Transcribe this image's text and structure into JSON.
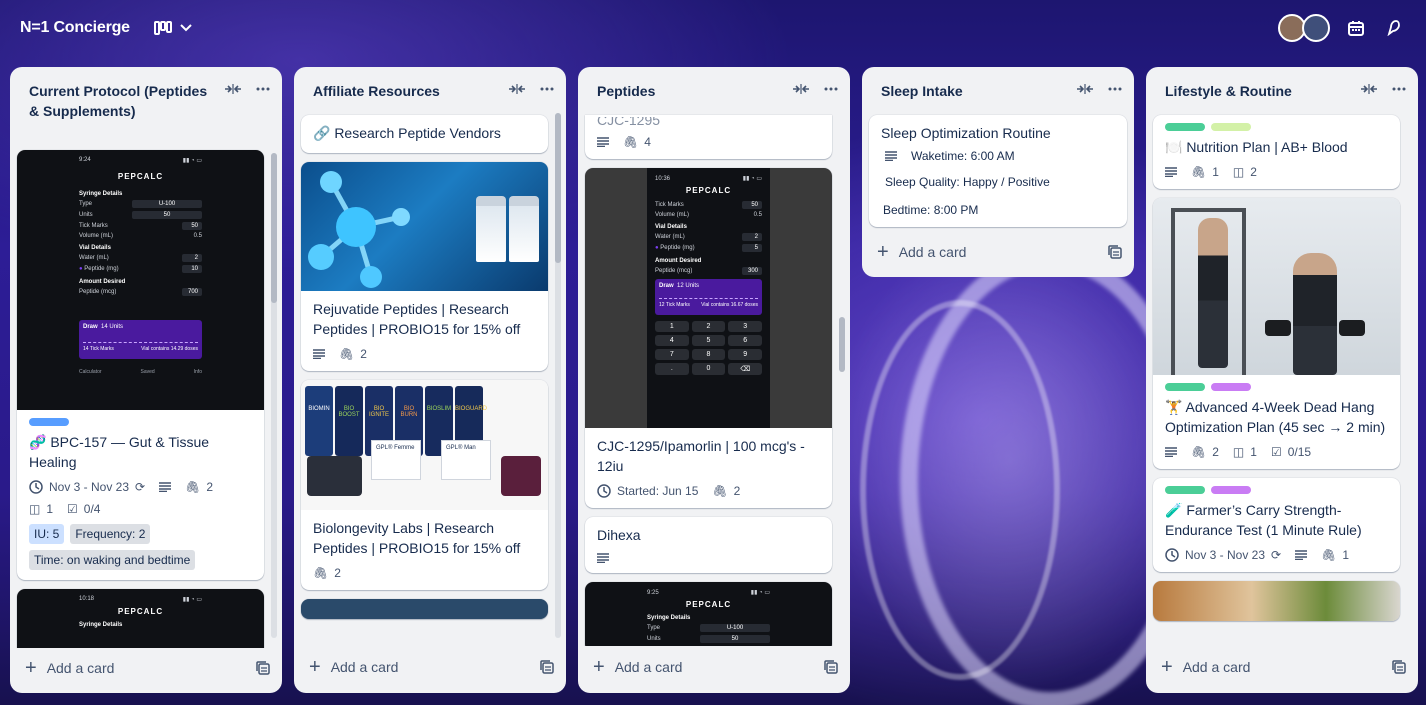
{
  "board": {
    "title": "N=1 Concierge"
  },
  "colors": {
    "label_blue": "#579dff",
    "label_green": "#4bce97",
    "label_lime": "#d3f1a7",
    "label_purple": "#c97cf4",
    "chip_iu": "#cce0ff",
    "chip_gray": "#dcdfe4"
  },
  "lists": [
    {
      "title": "Current Protocol (Peptides & Supplements)",
      "add_label": "Add a card",
      "cards": [
        {
          "title": "🧬 BPC-157 — Gut & Tissue Healing",
          "dates": "Nov 3 - Nov 23",
          "attachments": "2",
          "trello_links": "1",
          "checklist": "0/4",
          "chips": [
            "IU: 5",
            "Frequency: 2",
            "Time: on waking and bedtime"
          ],
          "cover": {
            "time": "9:24",
            "brand": "PEPCALC",
            "syringe_section": "Syringe Details",
            "type_label": "Type",
            "type_val": "U-100",
            "units_label": "Units",
            "units_val": "50",
            "ticks_label": "Tick Marks",
            "ticks_val": "50",
            "volume_label": "Volume (mL)",
            "volume_val": "0.5",
            "vial_section": "Vial Details",
            "water_label": "Water (mL)",
            "water_val": "2",
            "peptide_label": "Peptide (mg)",
            "peptide_val": "10",
            "amount_section": "Amount Desired",
            "mcg_label": "Peptide (mcg)",
            "mcg_val": "700",
            "draw_label": "Draw",
            "draw_units": "14 Units",
            "draw_ticks": "14 Tick Marks",
            "draw_contains": "Vial contains 14.29 doses",
            "tab1": "Calculator",
            "tab2": "Saved",
            "tab3": "Info"
          }
        },
        {
          "title": "",
          "cover": {
            "time": "10:18",
            "brand": "PEPCALC",
            "syringe_section": "Syringe Details"
          }
        }
      ]
    },
    {
      "title": "Affiliate Resources",
      "add_label": "Add a card",
      "cards": [
        {
          "title": "🔗 Research Peptide Vendors"
        },
        {
          "title": "Rejuvatide Peptides | Research Peptides | PROBIO15 for 15% off",
          "attachments": "2"
        },
        {
          "title": "Biolongevity Labs | Research Peptides | PROBIO15 for 15% off",
          "attachments": "2",
          "cover": {
            "vial1": "GPL® Femme",
            "vial2": "GPL® Man",
            "jar1": "BIOMIN",
            "jar2": "BIO BOOST",
            "jar3": "BIO IGNITE",
            "jar4": "BIO BURN",
            "jar5": "BIOSLIM",
            "jar6": "BIOGUARD"
          }
        }
      ]
    },
    {
      "title": "Peptides",
      "add_label": "Add a card",
      "cards": [
        {
          "title": "",
          "partial_text": "CJC-1295",
          "attachments": "4"
        },
        {
          "title": "CJC-1295/Ipamorlin | 100 mcg's - 12iu",
          "started": "Started: Jun 15",
          "attachments": "2",
          "cover": {
            "time": "10:36",
            "brand": "PEPCALC",
            "ticks_label": "Tick Marks",
            "ticks_val": "50",
            "volume_label": "Volume (mL)",
            "volume_val": "0.5",
            "vial_section": "Vial Details",
            "water_label": "Water (mL)",
            "water_val": "2",
            "peptide_label": "Peptide (mg)",
            "peptide_val": "5",
            "amount_section": "Amount Desired",
            "mcg_label": "Peptide (mcg)",
            "mcg_val": "300",
            "draw_label": "Draw",
            "draw_units": "12 Units",
            "draw_ticks": "12 Tick Marks",
            "draw_contains": "Vial contains 16.67 doses",
            "keys": [
              "1",
              "2",
              "3",
              "4",
              "5",
              "6",
              "7",
              "8",
              "9",
              ".",
              "0",
              "⌫"
            ]
          }
        },
        {
          "title": "Dihexa"
        },
        {
          "title": "",
          "cover": {
            "time": "9:25",
            "brand": "PEPCALC",
            "syringe_section": "Syringe Details",
            "type_label": "Type",
            "type_val": "U-100",
            "units_label": "Units",
            "units_val": "50"
          }
        }
      ]
    },
    {
      "title": "Sleep Intake",
      "add_label": "Add a card",
      "cards": [
        {
          "title": "Sleep Optimization Routine",
          "waketime": "Waketime: 6:00 AM",
          "quality": "Sleep Quality: Happy / Positive",
          "bedtime": "Bedtime: 8:00 PM"
        }
      ]
    },
    {
      "title": "Lifestyle & Routine",
      "add_label": "Add a card",
      "cards": [
        {
          "title": "🍽️ Nutrition Plan | AB+ Blood",
          "attachments": "1",
          "trello_links": "2"
        },
        {
          "title": "🏋️ Advanced 4-Week Dead Hang Optimization Plan (45 sec → 2 min)",
          "attachments": "2",
          "trello_links": "1",
          "checklist": "0/15"
        },
        {
          "title": "🧪 Farmer’s Carry Strength-Endurance Test (1 Minute Rule)",
          "dates": "Nov 3 - Nov 23",
          "attachments": "1"
        }
      ]
    }
  ]
}
